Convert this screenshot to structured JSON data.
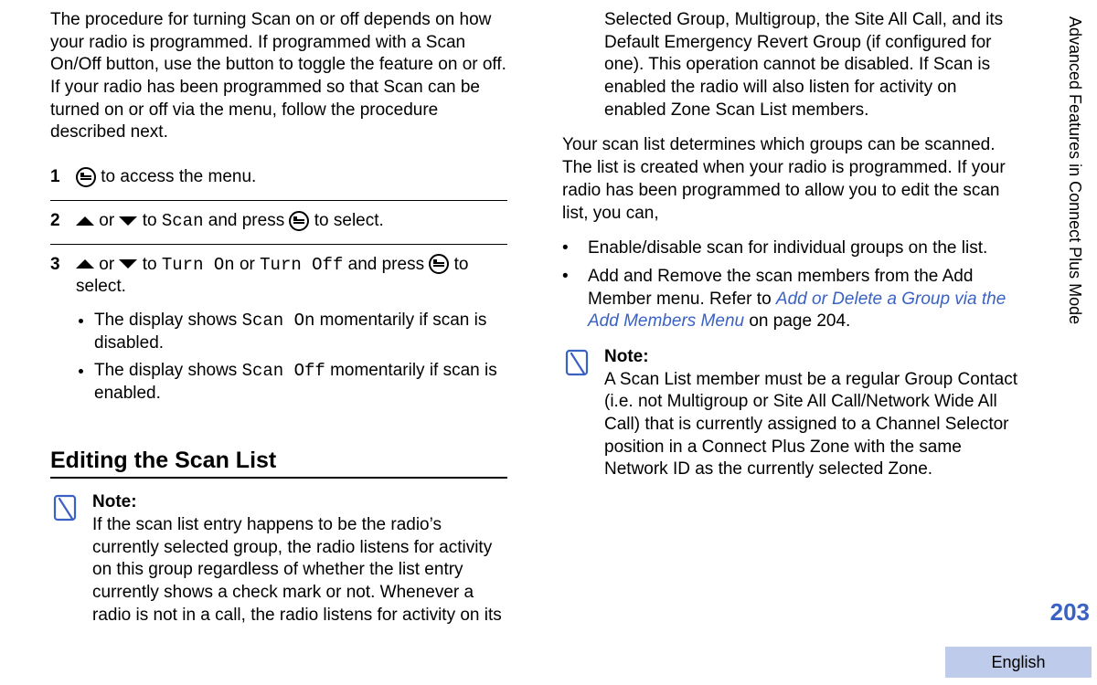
{
  "sideTab": "Advanced Features in Connect Plus Mode",
  "pageNumber": "203",
  "language": "English",
  "intro": "The procedure for turning Scan on or off depends on how your radio is programmed. If programmed with a Scan On/Off button, use the button to toggle the feature on or off. If your radio has been programmed so that Scan can be turned on or off via the menu, follow the procedure described next.",
  "steps": {
    "s1": {
      "num": "1",
      "text_after_icon": " to access the menu."
    },
    "s2": {
      "num": "2",
      "a": " or ",
      "b": " to ",
      "scan": "Scan",
      "c": " and press ",
      "d": " to select."
    },
    "s3": {
      "num": "3",
      "a": " or ",
      "b": " to ",
      "ton": "Turn On",
      "or": " or ",
      "toff": "Turn Off",
      "c": " and press ",
      "d": " to select.",
      "bullets": {
        "b1a": "The display shows ",
        "b1code": "Scan On",
        "b1b": " momentarily if scan is disabled.",
        "b2a": "The display shows ",
        "b2code": "Scan Off",
        "b2b": " momentarily if scan is enabled."
      }
    }
  },
  "heading": "Editing the Scan List",
  "note1": {
    "title": "Note:",
    "body": "If the scan list entry happens to be the radio’s currently selected group, the radio listens for activity on this group regardless of whether the list entry currently shows a check mark or not. Whenever a radio is not in a call, the radio listens for activity on its Selected Group, Multigroup, the Site All Call, and its Default Emergency Revert Group (if configured for one). This operation cannot be disabled. If Scan is enabled the radio will also listen for activity on enabled Zone Scan List members."
  },
  "paraAfterNote": "Your scan list determines which groups can be scanned. The list is created when your radio is programmed. If your radio has been programmed to allow you to edit the scan list, you can,",
  "editBullets": {
    "b1": "Enable/disable scan for individual groups on the list.",
    "b2a": "Add and Remove the scan members from the Add Member menu. Refer to ",
    "b2link": "Add or Delete a Group via the Add Members Menu",
    "b2b": " on page 204."
  },
  "note2": {
    "title": "Note:",
    "body": "A Scan List member must be a regular Group Contact (i.e. not Multigroup or Site All Call/Network Wide All Call) that is currently assigned to a Channel Selector position in a Connect Plus Zone with the same Network ID as the currently selected Zone."
  }
}
